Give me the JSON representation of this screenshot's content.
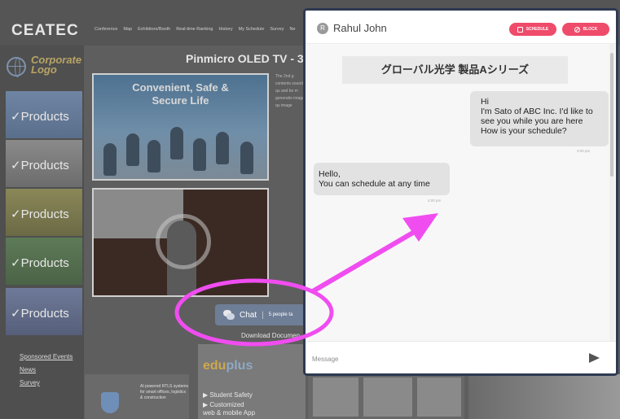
{
  "site": {
    "logo": "CEATEC",
    "nav": [
      "Conference",
      "Map",
      "Exhibitors/Booth",
      "Real-time Ranking",
      "History",
      "My Schedule",
      "Survey",
      "Ne"
    ],
    "corporate_logo": [
      "Corporate",
      "Logo"
    ],
    "products": [
      "✓Products",
      "✓Products",
      "✓Products",
      "✓Products",
      "✓Products"
    ],
    "sidebar_links": [
      "Sponsored Events",
      "News",
      "Survey"
    ],
    "page_title": "Pinmicro OLED TV - 33",
    "hero_caption": [
      "Convenient, Safe &",
      "Secure Life"
    ],
    "description": "The 2nd g contents sound qu and be m generatio image qu image",
    "chat_button": {
      "label": "Chat",
      "separator": "|",
      "sub": "5 people ta"
    },
    "download": "Download Documen",
    "ads": {
      "ad1_text": "AI powered RTLS systems for smart offices, logistics & construction",
      "brand_a": "edu",
      "brand_b": "plus",
      "bullets": [
        "▶ Student Safety",
        "▶ Customized",
        "   web & mobile App"
      ]
    }
  },
  "chat": {
    "avatar_initial": "R",
    "user_name": "Rahul John",
    "schedule_label": "SCHEDULE",
    "block_label": "BLOCK",
    "room_title": "グローバル光学 製品Aシリーズ",
    "messages": [
      {
        "side": "right",
        "lines": [
          "Hi",
          "I'm Sato of ABC Inc. I'd like to",
          "see you while you are here",
          "How is your schedule?"
        ],
        "time": "3:00 pm"
      },
      {
        "side": "left",
        "lines": [
          "Hello,",
          "You can schedule at any time"
        ],
        "time": "4:00 pm"
      }
    ],
    "input_placeholder": "Message"
  },
  "annotation_colors": {
    "highlight": "#f04df0"
  }
}
